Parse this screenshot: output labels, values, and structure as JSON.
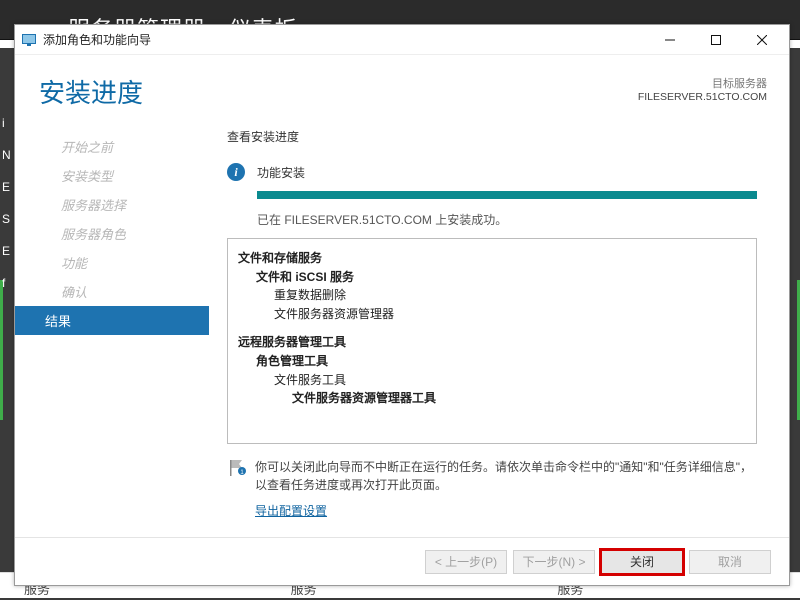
{
  "backdrop": {
    "app_title": "服务器管理器 · 仪表板",
    "bottom_cells": [
      "服务",
      "服务",
      "服务"
    ],
    "left_letters": [
      "i",
      "N",
      "E",
      "S",
      "E",
      "f"
    ]
  },
  "window": {
    "title": "添加角色和功能向导"
  },
  "header": {
    "page_title": "安装进度",
    "dest_label": "目标服务器",
    "dest_server": "FILESERVER.51CTO.COM"
  },
  "sidebar": {
    "items": [
      {
        "label": "开始之前"
      },
      {
        "label": "安装类型"
      },
      {
        "label": "服务器选择"
      },
      {
        "label": "服务器角色"
      },
      {
        "label": "功能"
      },
      {
        "label": "确认"
      },
      {
        "label": "结果"
      }
    ],
    "active_index": 6
  },
  "content": {
    "subhead": "查看安装进度",
    "status_text": "功能安装",
    "progress_percent": 100,
    "success_msg": "已在 FILESERVER.51CTO.COM 上安装成功。",
    "features": [
      {
        "lvl": 0,
        "t": "文件和存储服务"
      },
      {
        "lvl": 1,
        "t": "文件和 iSCSI 服务"
      },
      {
        "lvl": 2,
        "t": "重复数据删除"
      },
      {
        "lvl": 2,
        "t": "文件服务器资源管理器"
      },
      {
        "lvl": 0,
        "t": "远程服务器管理工具"
      },
      {
        "lvl": 1,
        "t": "角色管理工具"
      },
      {
        "lvl": 2,
        "t": "文件服务工具"
      },
      {
        "lvl": 3,
        "t": "文件服务器资源管理器工具"
      }
    ],
    "note_text": "你可以关闭此向导而不中断正在运行的任务。请依次单击命令栏中的\"通知\"和\"任务详细信息\"，以查看任务进度或再次打开此页面。",
    "export_link": "导出配置设置"
  },
  "footer": {
    "back": "< 上一步(P)",
    "next": "下一步(N) >",
    "close": "关闭",
    "cancel": "取消"
  }
}
